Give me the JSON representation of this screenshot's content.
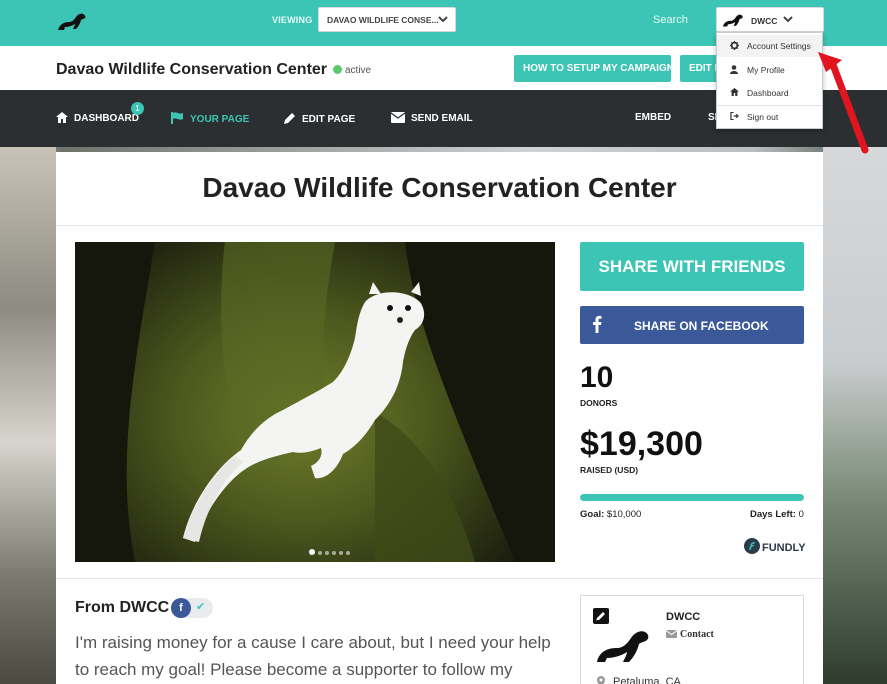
{
  "topbar": {
    "viewing_label": "VIEWING",
    "viewing_value": "DAVAO WILDLIFE CONSE...",
    "search_label": "Search",
    "user_label": "DWCC"
  },
  "user_menu": {
    "items": [
      {
        "label": "Account Settings",
        "icon": "gear-icon"
      },
      {
        "label": "My Profile",
        "icon": "user-icon"
      },
      {
        "label": "Dashboard",
        "icon": "home-icon"
      },
      {
        "label": "Sign out",
        "icon": "sign-out-icon"
      }
    ]
  },
  "titlebar": {
    "org_name": "Davao Wildlife Conservation Center",
    "status": "active",
    "howto_button": "HOW TO SETUP MY CAMPAIGN",
    "edit_button": "EDIT P"
  },
  "nav": {
    "dashboard": "DASHBOARD",
    "dashboard_badge": "1",
    "your_page": "YOUR PAGE",
    "edit_page": "EDIT PAGE",
    "send_email": "SEND EMAIL",
    "embed": "EMBED",
    "share_partial": "SH"
  },
  "campaign": {
    "heading": "Davao Wildlife Conservation Center",
    "share_friends": "SHARE WITH FRIENDS",
    "share_facebook": "SHARE ON FACEBOOK",
    "donors_count": "10",
    "donors_label": "DONORS",
    "raised_amount": "$19,300",
    "raised_label": "RAISED (USD)",
    "progress_fraction": 1.0,
    "goal_label": "Goal:",
    "goal_value": "$10,000",
    "days_label": "Days Left:",
    "days_value": "0",
    "brand": "FUNDLY"
  },
  "from_section": {
    "title": "From DWCC",
    "story": "I'm raising money for a cause I care about, but I need your help to reach my goal! Please become a supporter to follow my"
  },
  "organizer_card": {
    "name": "DWCC",
    "contact": "Contact",
    "location": "Petaluma, CA"
  },
  "colors": {
    "teal": "#3cc4b4",
    "dark_nav": "#2b2f31",
    "facebook": "#3b5998",
    "arrow": "#e0151f"
  }
}
